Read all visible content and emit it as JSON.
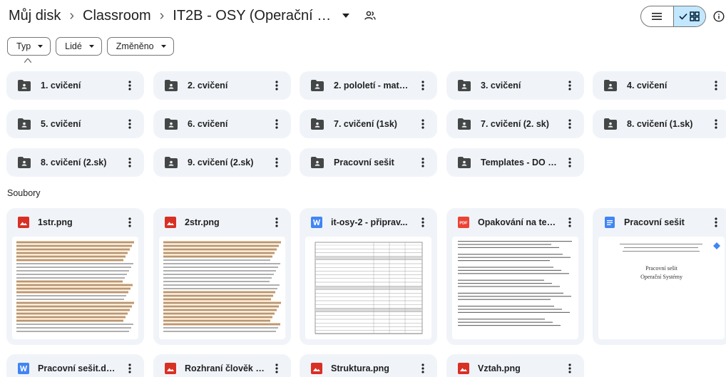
{
  "breadcrumb": {
    "root": "Můj disk",
    "parent": "Classroom",
    "current": "IT2B - OSY (Operační sy..."
  },
  "filters": [
    {
      "label": "Typ"
    },
    {
      "label": "Lidé"
    },
    {
      "label": "Změněno"
    }
  ],
  "folders": [
    {
      "name": "1. cvičení"
    },
    {
      "name": "2. cvičení"
    },
    {
      "name": "2. pololetí - mater..."
    },
    {
      "name": "3. cvičení"
    },
    {
      "name": "4. cvičení"
    },
    {
      "name": "5. cvičení"
    },
    {
      "name": "6. cvičení"
    },
    {
      "name": "7. cvičení (1sk)"
    },
    {
      "name": "7. cvičení (2. sk)"
    },
    {
      "name": "8. cvičení (1.sk)"
    },
    {
      "name": "8. cvičení (2.sk)"
    },
    {
      "name": "9. cvičení (2.sk)"
    },
    {
      "name": "Pracovní sešit"
    },
    {
      "name": "Templates - DO N..."
    }
  ],
  "files_section_label": "Soubory",
  "files": [
    {
      "name": "1str.png",
      "type": "image"
    },
    {
      "name": "2str.png",
      "type": "image"
    },
    {
      "name": "it-osy-2 - připrav...",
      "type": "word"
    },
    {
      "name": "Opakování na test...",
      "type": "pdf"
    },
    {
      "name": "Pracovní sešit",
      "type": "gdoc"
    },
    {
      "name": "Pracovní sešit.docx",
      "type": "word"
    },
    {
      "name": "Rozhraní člověk s...",
      "type": "image"
    },
    {
      "name": "Struktura.png",
      "type": "image"
    },
    {
      "name": "Vztah.png",
      "type": "image"
    }
  ],
  "thumbnails": {
    "pracovni_sesit_title": "Pracovní sešit",
    "pracovni_sesit_subtitle": "Operační Systémy"
  },
  "colors": {
    "folder_bg": "#f0f4f9",
    "accent_selected": "#c2e7ff",
    "image_icon": "#d93025",
    "word_icon": "#4285f4",
    "gdoc_icon": "#4285f4",
    "pdf_icon": "#ea4335",
    "highlight": "#f9cb9c"
  },
  "icons": {
    "folder": "shared-folder-icon",
    "share": "people-icon",
    "list_view": "list-view-icon",
    "grid_view": "grid-view-icon",
    "info": "info-icon",
    "more": "more-vert-icon"
  }
}
